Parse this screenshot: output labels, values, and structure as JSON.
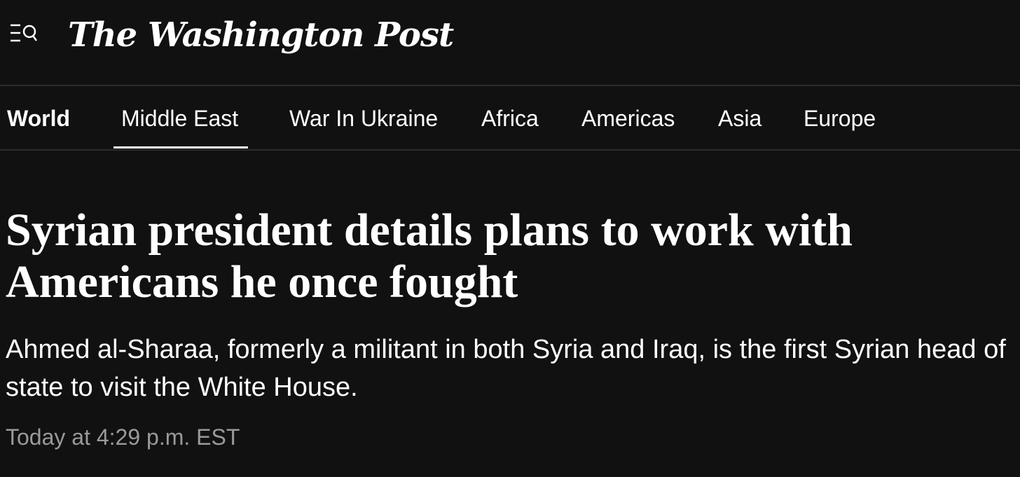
{
  "header": {
    "logo_text": "The Washington Post",
    "menu_icon": "menu-search-icon"
  },
  "nav": {
    "section": "World",
    "items": [
      {
        "label": "Middle East",
        "active": true
      },
      {
        "label": "War In Ukraine",
        "active": false
      },
      {
        "label": "Africa",
        "active": false
      },
      {
        "label": "Americas",
        "active": false
      },
      {
        "label": "Asia",
        "active": false
      },
      {
        "label": "Europe",
        "active": false
      }
    ]
  },
  "article": {
    "headline": "Syrian president details plans to work with Americans he once fought",
    "dek": "Ahmed al-Sharaa, formerly a militant in both Syria and Iraq, is the first Syrian head of state to visit the White House.",
    "timestamp": "Today at 4:29 p.m. EST"
  },
  "colors": {
    "background": "#111111",
    "text": "#ffffff",
    "muted": "#9a9a9a",
    "divider": "#2c2c2c"
  }
}
